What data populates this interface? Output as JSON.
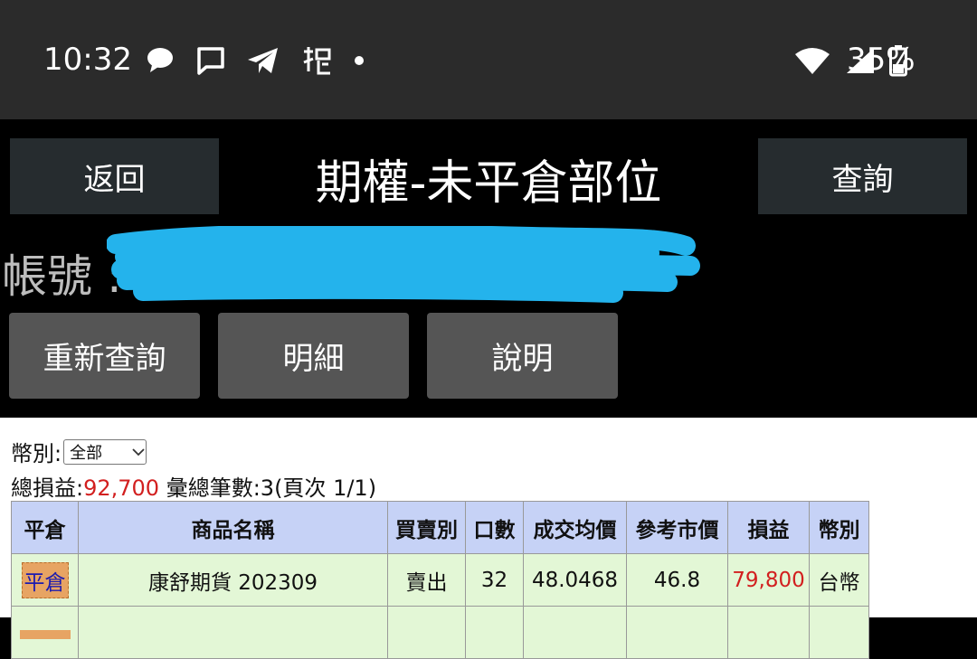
{
  "status": {
    "time": "10:32",
    "battery": "35%",
    "icons_left": [
      "chat-bubble-icon",
      "message-icon",
      "telegram-icon",
      "app-icon",
      "dot-icon"
    ],
    "icons_right": [
      "wifi-icon",
      "signal-icon",
      "battery-icon"
    ]
  },
  "header": {
    "back_label": "返回",
    "title": "期權-未平倉部位",
    "query_label": "查詢"
  },
  "account": {
    "label": "帳號 :"
  },
  "actions": {
    "requery": "重新查詢",
    "detail": "明細",
    "explain": "說明"
  },
  "filter": {
    "currency_label": "幣別:",
    "currency_value": "全部"
  },
  "summary": {
    "pnl_label": "總損益:",
    "pnl_value": "92,700",
    "count_text": "彙總筆數:3(頁次 1/1)"
  },
  "table": {
    "headers": [
      "平倉",
      "商品名稱",
      "買賣別",
      "口數",
      "成交均價",
      "參考市價",
      "損益",
      "幣別"
    ],
    "rows": [
      {
        "action": "平倉",
        "product": "康舒期貨 202309",
        "side": "賣出",
        "qty": "32",
        "avg_price": "48.0468",
        "ref_price": "46.8",
        "pnl": "79,800",
        "currency": "台幣"
      }
    ]
  },
  "colors": {
    "header_bg": "#c6d2f6",
    "row_bg": "#e3f7d6",
    "pnl_red": "#d21f1f",
    "close_tag": "#e7a463"
  }
}
